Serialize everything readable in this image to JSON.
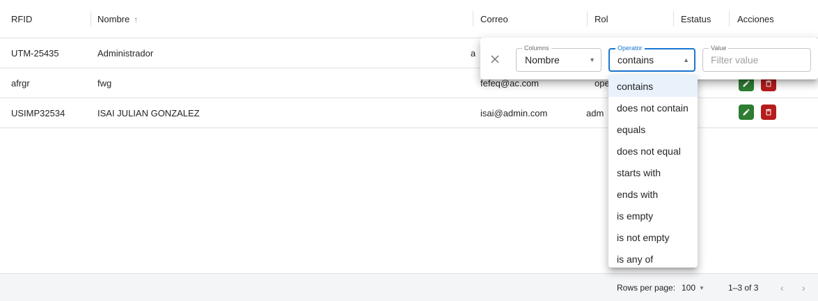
{
  "columns": {
    "rfid": "RFID",
    "nombre": "Nombre",
    "correo": "Correo",
    "rol": "Rol",
    "estatus": "Estatus",
    "acciones": "Acciones"
  },
  "rows": [
    {
      "rfid": "UTM-25435",
      "nombre": "Administrador",
      "correo": "a",
      "rol": ""
    },
    {
      "rfid": "afrgr",
      "nombre": "fwg",
      "correo": "fefeq@ac.com",
      "rol": "ope"
    },
    {
      "rfid": "USIMP32534",
      "nombre": "ISAI JULIAN GONZALEZ",
      "correo": "isai@admin.com",
      "rol": "adm"
    }
  ],
  "filter": {
    "columns_label": "Columns",
    "columns_value": "Nombre",
    "operator_label": "Operator",
    "operator_value": "contains",
    "value_label": "Value",
    "value_placeholder": "Filter value",
    "operators": [
      "contains",
      "does not contain",
      "equals",
      "does not equal",
      "starts with",
      "ends with",
      "is empty",
      "is not empty",
      "is any of"
    ],
    "selected_operator_index": 0
  },
  "footer": {
    "rows_per_page_label": "Rows per page:",
    "rows_per_page_value": "100",
    "range": "1–3 of 3"
  },
  "icons": {
    "sort": "arrow-up-icon",
    "close": "close-icon",
    "edit": "pencil-icon",
    "delete": "trash-icon",
    "dropdown": "caret-down-icon",
    "prev": "chevron-left-icon",
    "next": "chevron-right-icon"
  },
  "colors": {
    "accent": "#1976d2",
    "edit_button": "#2e7d32",
    "delete_button": "#b71c1c",
    "selected_option": "#e9f1fb",
    "footer_bg": "#f4f5f7"
  }
}
